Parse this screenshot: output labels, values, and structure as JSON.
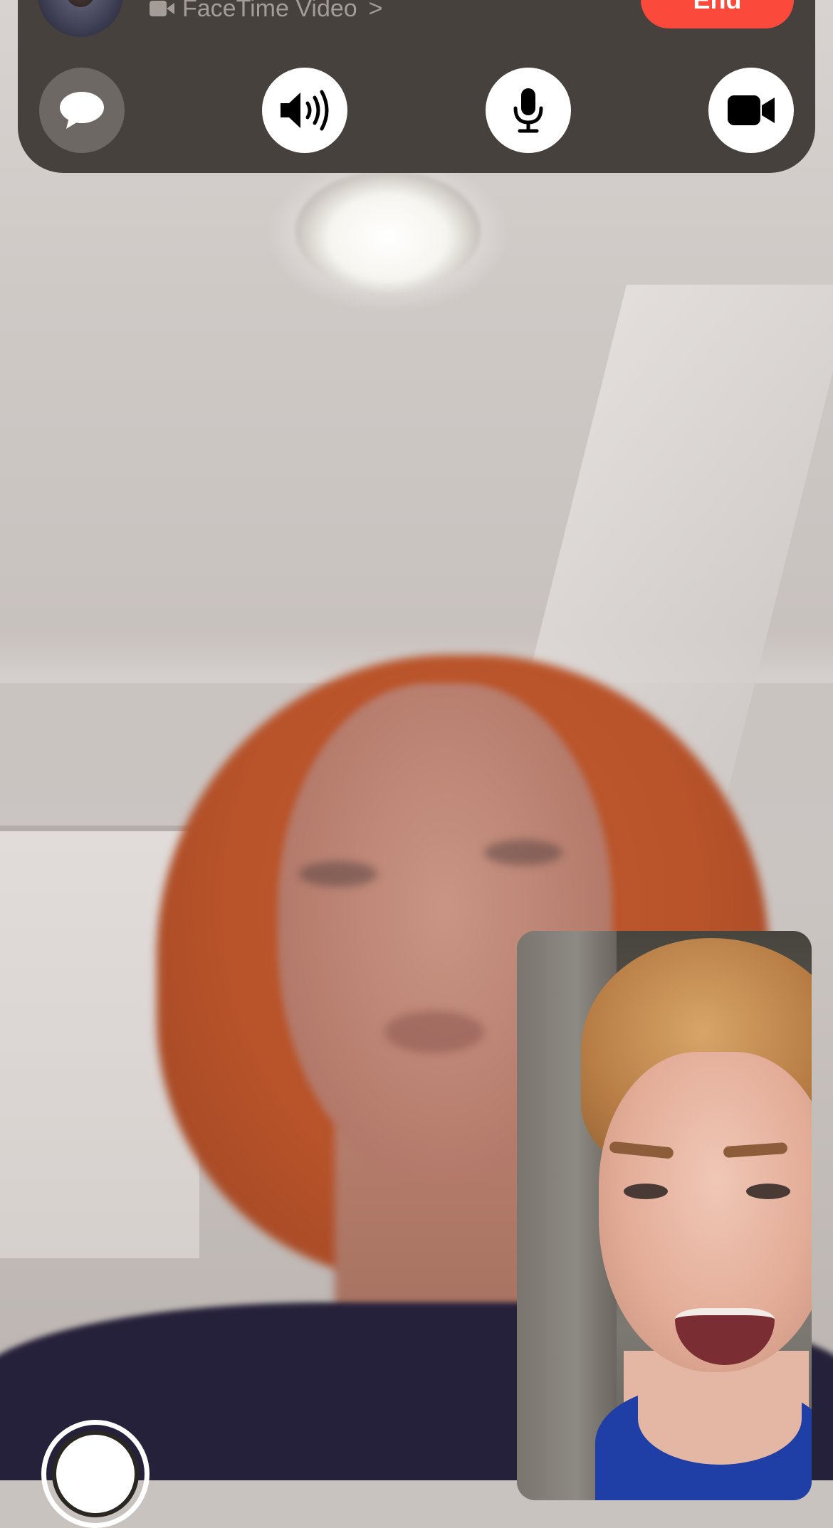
{
  "call": {
    "subtitle": "FaceTime Video",
    "subtitle_icon": "video-camera-icon",
    "chevron": ">",
    "end_label": "End"
  },
  "controls": [
    {
      "name": "messages",
      "icon": "message-bubble-icon",
      "state": "gray"
    },
    {
      "name": "speaker",
      "icon": "speaker-icon",
      "state": "active"
    },
    {
      "name": "microphone",
      "icon": "microphone-icon",
      "state": "active"
    },
    {
      "name": "camera",
      "icon": "video-camera-icon",
      "state": "active"
    }
  ],
  "colors": {
    "panel": "#423c38",
    "end_button": "#fb4a3c",
    "control_active": "#ffffff",
    "control_inactive": "#6e6864",
    "subtitle_text": "#a49c97"
  }
}
